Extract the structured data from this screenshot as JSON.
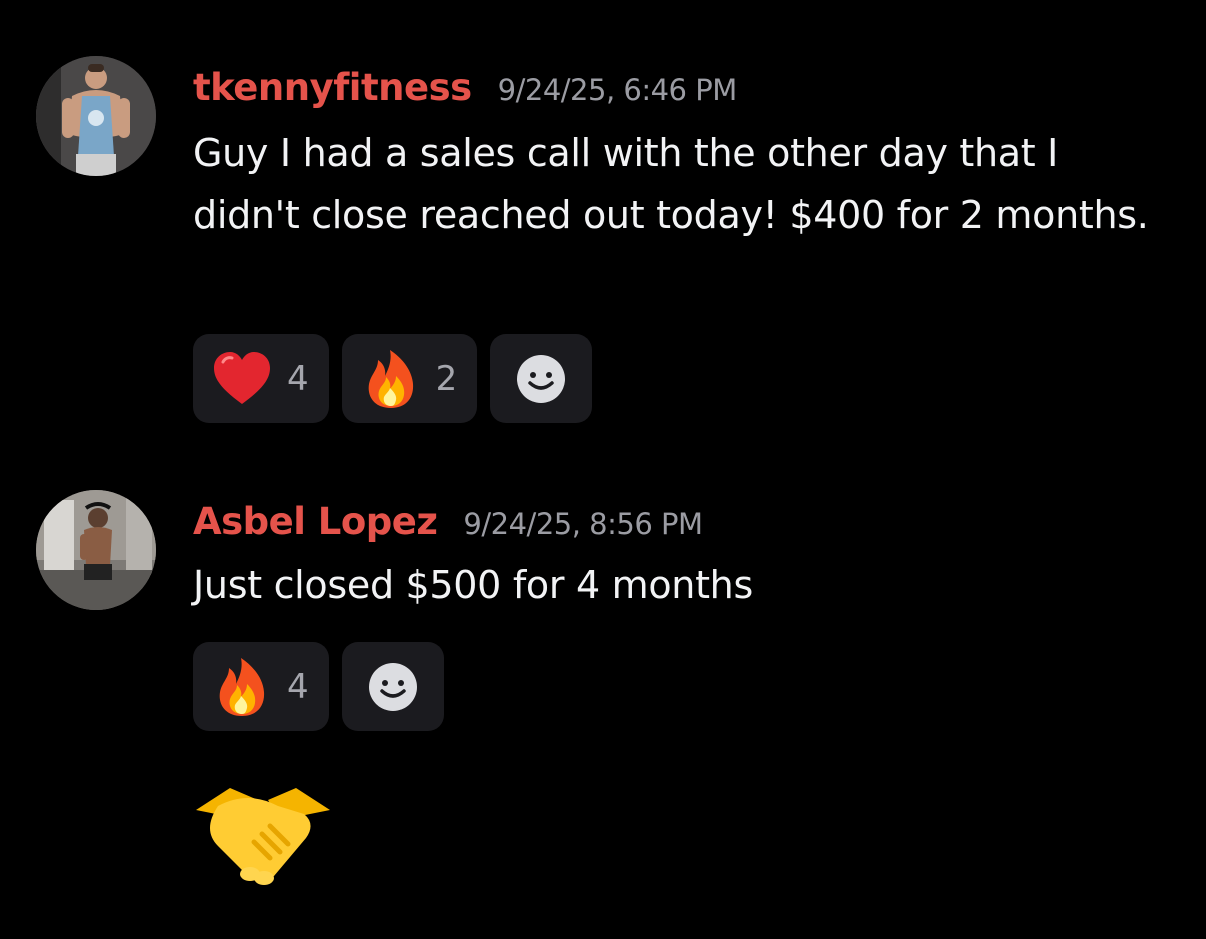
{
  "messages": [
    {
      "username": "tkennyfitness",
      "username_color": "#e5534b",
      "timestamp": "9/24/25, 6:46 PM",
      "text": "Guy I had a sales call with the other day that I didn't close reached out today! $400 for 2 months.",
      "avatar": "avatar-man-blue-tanktop",
      "reactions": [
        {
          "emoji": "heart-icon",
          "count": "4"
        },
        {
          "emoji": "fire-icon",
          "count": "2"
        }
      ]
    },
    {
      "username": "Asbel Lopez",
      "username_color": "#e5534b",
      "timestamp": "9/24/25, 8:56 PM",
      "text": "Just closed $500 for 4 months",
      "avatar": "avatar-mirror-selfie",
      "reactions": [
        {
          "emoji": "fire-icon",
          "count": "4"
        }
      ]
    }
  ],
  "followup": {
    "emoji": "handshake-icon"
  },
  "colors": {
    "background": "#000000",
    "reaction_bg": "#1b1b1f",
    "timestamp": "#9b9ca3",
    "text": "#f2f3f5"
  }
}
